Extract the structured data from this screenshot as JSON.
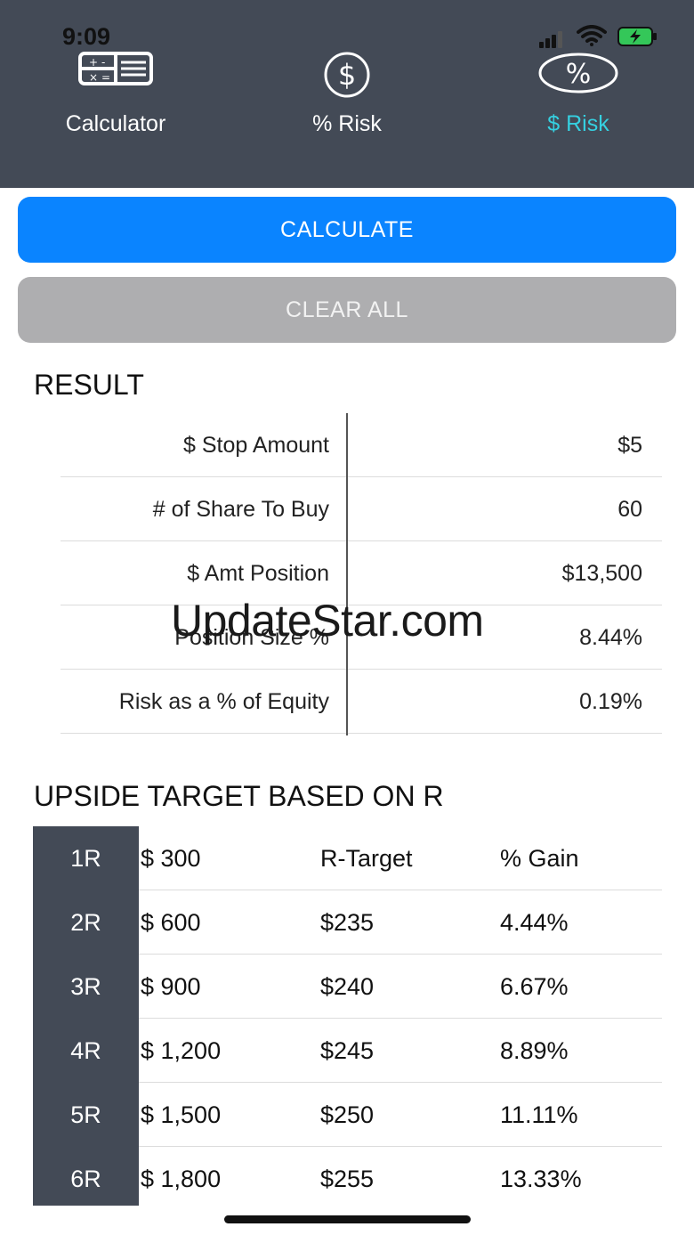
{
  "status_bar": {
    "time": "9:09"
  },
  "tabs": [
    {
      "label": "Calculator",
      "icon": "calculator-icon",
      "active": false
    },
    {
      "label": "% Risk",
      "icon": "dollar-circle-icon",
      "active": false
    },
    {
      "label": "$ Risk",
      "icon": "percent-oval-icon",
      "active": true
    }
  ],
  "buttons": {
    "calculate": "CALCULATE",
    "clear_all": "CLEAR ALL"
  },
  "result": {
    "title": "RESULT",
    "rows": [
      {
        "label": "$ Stop Amount",
        "value": "$5"
      },
      {
        "label": "# of Share To Buy",
        "value": "60"
      },
      {
        "label": "$ Amt Position",
        "value": "$13,500"
      },
      {
        "label": "Position Size %",
        "value": "8.44%"
      },
      {
        "label": "Risk as a % of Equity",
        "value": "0.19%"
      }
    ]
  },
  "upside": {
    "title": "UPSIDE TARGET BASED ON R",
    "header": {
      "r": "1R",
      "amount": "$ 300",
      "target": "R-Target",
      "gain": "% Gain"
    },
    "rows": [
      {
        "r": "2R",
        "amount": "$ 600",
        "target": "$235",
        "gain": "4.44%"
      },
      {
        "r": "3R",
        "amount": "$ 900",
        "target": "$240",
        "gain": "6.67%"
      },
      {
        "r": "4R",
        "amount": "$ 1,200",
        "target": "$245",
        "gain": "8.89%"
      },
      {
        "r": "5R",
        "amount": "$ 1,500",
        "target": "$250",
        "gain": "11.11%"
      },
      {
        "r": "6R",
        "amount": "$ 1,800",
        "target": "$255",
        "gain": "13.33%"
      }
    ]
  },
  "watermark": "UpdateStar.com",
  "colors": {
    "header_bg": "#434a56",
    "accent": "#0a84ff",
    "active_tab": "#35d0e0",
    "clear_button": "#aeaeb0"
  }
}
